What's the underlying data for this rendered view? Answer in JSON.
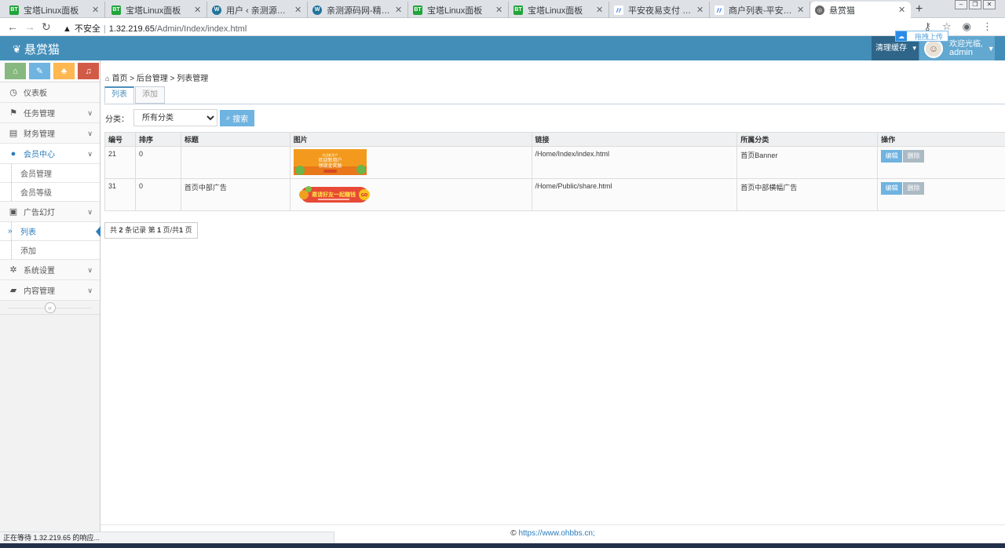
{
  "browser": {
    "tabs": [
      {
        "icon": "bt",
        "title": "宝塔Linux面板"
      },
      {
        "icon": "bt",
        "title": "宝塔Linux面板"
      },
      {
        "icon": "wp",
        "title": "用户 ‹ 亲测源码网 — W"
      },
      {
        "icon": "wp",
        "title": "亲测源码网-精品资源站"
      },
      {
        "icon": "bt",
        "title": "宝塔Linux面板"
      },
      {
        "icon": "bt",
        "title": "宝塔Linux面板"
      },
      {
        "icon": "pay",
        "title": "平安夜易支付 - 一站式"
      },
      {
        "icon": "pay",
        "title": "商户列表-平安夜易支付"
      },
      {
        "icon": "globe",
        "title": "悬赏猫"
      }
    ],
    "insecure_label": "不安全",
    "url_host": "1.32.219.65",
    "url_path": "/Admin/Index/index.html",
    "status_text": "正在等待 1.32.219.65 的响应..."
  },
  "app": {
    "brand": "悬赏猫",
    "clear_cache": "清理缓存",
    "welcome": "欢迎光临,",
    "username": "admin",
    "upload_badge": "拖拽上传"
  },
  "sidebar": {
    "items": [
      {
        "name": "dashboard",
        "icon": "dashboard-icon",
        "glyph": "◷",
        "label": "仪表板",
        "has_children": false
      },
      {
        "name": "task-management",
        "icon": "flag-icon",
        "glyph": "⚑",
        "label": "任务管理",
        "has_children": true
      },
      {
        "name": "finance-management",
        "icon": "wallet-icon",
        "glyph": "▤",
        "label": "财务管理",
        "has_children": true
      },
      {
        "name": "member-center",
        "icon": "user-icon",
        "glyph": "●",
        "label": "会员中心",
        "has_children": true,
        "open": true,
        "children": [
          {
            "label": "会员管理"
          },
          {
            "label": "会员等级"
          }
        ]
      },
      {
        "name": "ad-slides",
        "icon": "picture-icon",
        "glyph": "▣",
        "label": "广告幻灯",
        "has_children": true,
        "open": true,
        "children": [
          {
            "label": "列表",
            "active": true
          },
          {
            "label": "添加"
          }
        ]
      },
      {
        "name": "system-settings",
        "icon": "gear-icon",
        "glyph": "✲",
        "label": "系统设置",
        "has_children": true
      },
      {
        "name": "content-management",
        "icon": "book-icon",
        "glyph": "▰",
        "label": "内容管理",
        "has_children": true
      }
    ]
  },
  "main": {
    "breadcrumb": [
      "首页",
      "后台管理",
      "列表管理"
    ],
    "tabs": [
      "列表",
      "添加"
    ],
    "filter_label": "分类：",
    "filter_selected": "所有分类",
    "search_label": "搜索",
    "columns": [
      "编号",
      "排序",
      "标题",
      "图片",
      "链接",
      "所属分类",
      "操作"
    ],
    "rows": [
      {
        "id": "21",
        "sort": "0",
        "title": "",
        "image_text": "欢迎新用户 欢迎新用户 领现金奖励",
        "link": "/Home/Index/index.html",
        "category": "首页Banner",
        "edit": "编辑",
        "delete": "删除"
      },
      {
        "id": "31",
        "sort": "0",
        "title": "首页中部广告",
        "image_text": "邀请好友一起赚钱",
        "link": "/Home/Public/share.html",
        "category": "首页中部横幅广告",
        "edit": "编辑",
        "delete": "删除"
      }
    ],
    "pager": {
      "prefix": "共",
      "total": "2",
      "mid": "条记录 第",
      "page": "1",
      "sep": "页/共",
      "pages": "1",
      "suffix": "页"
    }
  },
  "footer": {
    "copyright": "©",
    "link": "https://www.ohbbs.cn;"
  },
  "colors": {
    "header": "#438eb9",
    "accent": "#6fb3e0",
    "sidebar_active": "#2b7dbc"
  }
}
